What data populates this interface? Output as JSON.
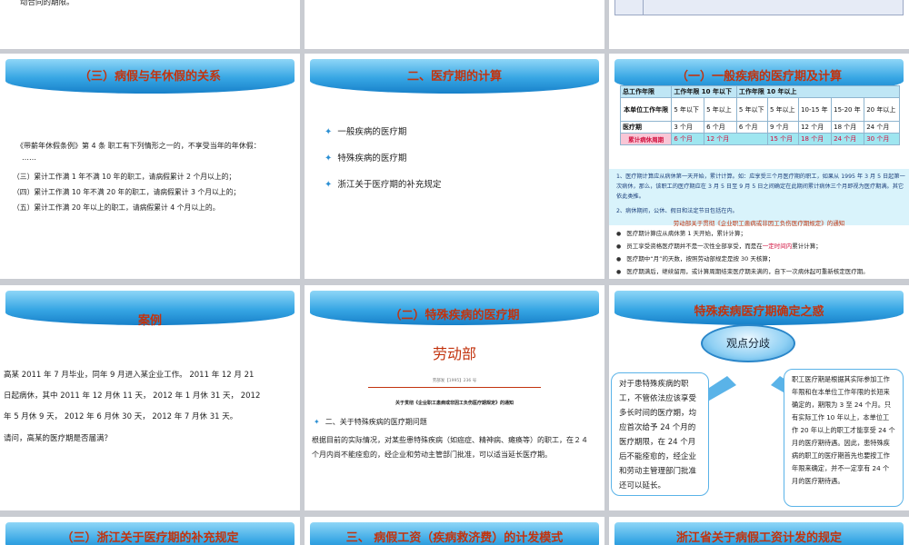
{
  "row0": {
    "s1_text": "动合同的期限。"
  },
  "s4": {
    "title": "（三）病假与年休假的关系",
    "lead": "《带薪年休假条例》第 4 条  职工有下列情形之一的，不享受当年的年休假：",
    "ellipsis": "……",
    "items": [
      "（三）累计工作满 1 年不满 10 年的职工，请病假累计 2 个月以上的；",
      "（四）累计工作满 10 年不满 20 年的职工，请病假累计 3 个月以上的；",
      "（五）累计工作满 20 年以上的职工，请病假累计 4 个月以上的。"
    ]
  },
  "s5": {
    "title": "二、医疗期的计算",
    "items": [
      "一般疾病的医疗期",
      "特殊疾病的医疗期",
      "浙江关于医疗期的补充规定"
    ]
  },
  "s6": {
    "title": "（一）一般疾病的医疗期及计算",
    "table": {
      "h1": [
        "总工作年限",
        "工作年限 10 年以下",
        "工作年限 10 年以上"
      ],
      "r2_label": "本单位工作年限",
      "r2": [
        "5 年以下",
        "5 年以上",
        "5 年以下",
        "5 年以上",
        "10-15 年",
        "15-20 年",
        "20 年以上"
      ],
      "r3_label": "医疗期",
      "r3": [
        "3 个月",
        "6 个月",
        "6 个月",
        "9 个月",
        "12 个月",
        "18 个月",
        "24 个月"
      ],
      "r4_label": "累计病休周期",
      "r4": [
        "6 个月",
        "12 个月",
        "",
        "15 个月",
        "18 个月",
        "24 个月",
        "30 个月"
      ]
    },
    "note1": "1、医疗期计算应从病休第一天开始，累计计算。如：应享受三个月医疗期的职工，如果从 1995 年 3 月 5 日起第一次病休，那么，该职工的医疗期应在 3 月 5 日至 9 月 5 日之间确定在此期间累计病休三个月即视为医疗期满。其它依此类推。",
    "note2": "2、病休期间，公休、假日和法定节日包括在内。",
    "notice": "劳动部关于贯彻《企业职工患病或非因工负伤医疗期规定》的通知",
    "bul1": "医疗期计算应从病休第 1 天开始，累计计算；",
    "bul2a": "员工享受资格医疗期并不是一次性全部享受，而是在",
    "bul2b": "一定时间内",
    "bul2c": "累计计算；",
    "bul3": "医疗期中“月”的天数，按照劳动部规定是按 30 天核算；",
    "bul4": "医疗期满后，继续留用，或计算周期结束医疗期未满的，自下一次病休起可重新核定医疗期。"
  },
  "s7": {
    "title": "案例",
    "lines": [
      "高某 2011 年 7 月毕业，同年 9 月进入某企业工作。 2011 年 12 月 21",
      "日起病休，其中 2011 年 12 月休 11 天， 2012 年 1 月休 31 天， 2012",
      "年 5 月休 9 天， 2012 年 6 月休 30 天， 2012 年 7 月休 31 天。",
      "请问，高某的医疗期是否届满？"
    ]
  },
  "s8": {
    "title": "（二）特殊疾病的医疗期",
    "doc_head": "劳动部",
    "doc_no": "劳部发【1995】236 号",
    "doc_title": "关于贯彻《企业职工患病或非因工负伤医疗期规定》的通知",
    "sub": "二、关于特殊疾病的医疗期问题",
    "body": "根据目前的实际情况，对某些患特殊疾病（如癌症、精神病、瘫痪等）的职工，在２４个月内尚不能痊愈的，经企业和劳动主管部门批准，可以适当延长医疗期。"
  },
  "s9": {
    "title": "特殊疾病医疗期确定之惑",
    "center": "观点分歧",
    "left": "对于患特殊疾病的职工，不管依法应该享受多长时间的医疗期，均应首次给予 24 个月的医疗期限，在 24 个月后不能痊愈的，经企业和劳动主管理部门批准还可以延长。",
    "right": "职工医疗期是根据其实际参加工作年限和在本单位工作年限的长短来确定的，期限为 3 至 24 个月。只有实际工作 10 年以上，本单位工作 20 年以上的职工才能享受 24 个月的医疗期待遇。因此，患特殊疾病的职工的医疗期首先也要按工作年限来确定，并不一定享有 24 个月的医疗期待遇。"
  },
  "row3": {
    "t1": "（三）浙江关于医疗期的补充规定",
    "t2": "三、 病假工资（疾病救济费）的计发模式",
    "t3": "浙江省关于病假工资计发的规定"
  },
  "colors": {
    "banner": "#37a6e4",
    "title_red": "#c2330e",
    "bullet_blue": "#2b8fd3",
    "table_head": "#bfe6f5",
    "table_pink": "#f9c6d6",
    "table_cyan": "#9fe6f0"
  }
}
